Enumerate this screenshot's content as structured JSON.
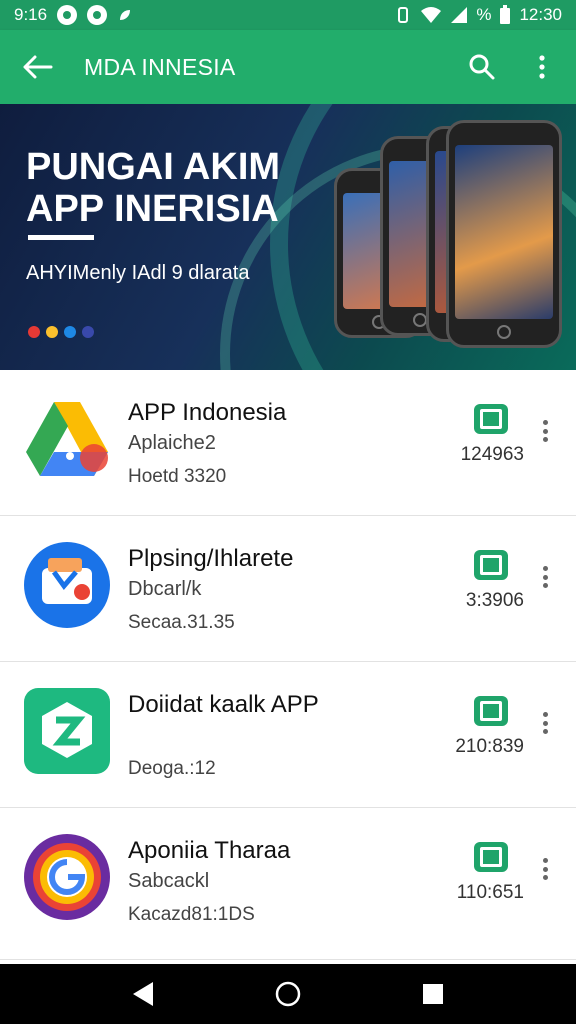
{
  "status": {
    "time_left": "9:16",
    "percent": "%",
    "clock": "12:30"
  },
  "app_bar": {
    "title": "MDA INNESIA",
    "back_icon": "arrow-left-icon",
    "search_icon": "search-icon",
    "menu_icon": "more-vert-icon"
  },
  "banner": {
    "title": "PUNGAI AKIM APP INERISIA",
    "subtitle": "AHYIMenly IAdl 9 dlarata",
    "dots": [
      "#e53935",
      "#fbc02d",
      "#1e88e5",
      "#3949ab"
    ]
  },
  "apps": [
    {
      "title": "APP Indonesia",
      "subtitle": "Aplaiche2",
      "meta": "Hoetd 3320",
      "size": "124963",
      "icon": "google-drive-icon"
    },
    {
      "title": "Plpsing/Ihlarete",
      "subtitle": "Dbcarl/k",
      "meta": "Secaa.31.35",
      "size": "3:3906",
      "icon": "wallet-icon"
    },
    {
      "title": "Doiidat kaalk APP",
      "subtitle": "",
      "meta": "Deoga.:12",
      "size": "210:839",
      "icon": "hexagon-logo-icon"
    },
    {
      "title": "Aponiia Tharaa",
      "subtitle": "Sabcackl",
      "meta": "Kacazd81:1DS",
      "size": "110:651",
      "icon": "google-circle-icon"
    }
  ],
  "nav": {
    "back": "nav-back-icon",
    "home": "nav-home-icon",
    "recents": "nav-recents-icon"
  }
}
